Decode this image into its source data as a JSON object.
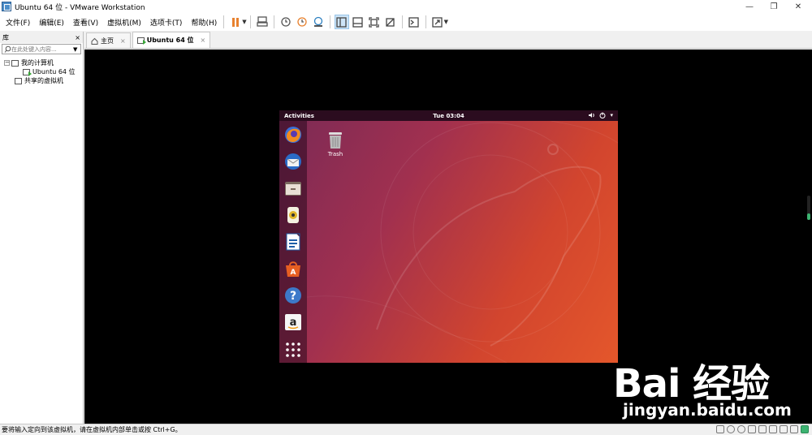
{
  "window": {
    "title": "Ubuntu 64 位 - VMware Workstation",
    "controls": [
      "—",
      "❐",
      "✕"
    ]
  },
  "menu": [
    "文件(F)",
    "编辑(E)",
    "查看(V)",
    "虚拟机(M)",
    "选项卡(T)",
    "帮助(H)"
  ],
  "toolbar": {
    "icons": [
      "pause-icon",
      "send-ctrl-alt-del-icon",
      "snapshot-icon",
      "revert-snapshot-icon",
      "snapshot-manager-icon",
      "library-view-icon",
      "thumbnail-view-icon",
      "fit-guest-icon",
      "free-stretch-icon",
      "console-icon",
      "fullscreen-icon"
    ]
  },
  "library": {
    "title": "库",
    "close": "×",
    "search_placeholder": "在此处键入内容...",
    "tree": {
      "root": "我的计算机",
      "vm": "Ubuntu 64 位",
      "shared": "共享的虚拟机"
    }
  },
  "tabs": [
    {
      "label": "主页",
      "close": "×"
    },
    {
      "label": "Ubuntu 64 位",
      "close": "×"
    }
  ],
  "guest": {
    "activities": "Activities",
    "clock": "Tue 03:04",
    "trash_label": "Trash",
    "dock_apps": [
      "firefox-icon",
      "thunderbird-icon",
      "files-icon",
      "rhythmbox-icon",
      "writer-icon",
      "software-center-icon",
      "help-icon",
      "amazon-icon",
      "show-apps-icon"
    ]
  },
  "status": {
    "text": "要将输入定向到该虚拟机，请在虚拟机内部单击或按 Ctrl+G。"
  },
  "watermark": {
    "main": "Bai 经验",
    "sub": "jingyan.baidu.com"
  },
  "colors": {
    "ubuntu_top": "#2b0c1f",
    "ubuntu_orange": "#e4572b",
    "ubuntu_purple": "#7a2a56",
    "pause": "#e8812e"
  }
}
